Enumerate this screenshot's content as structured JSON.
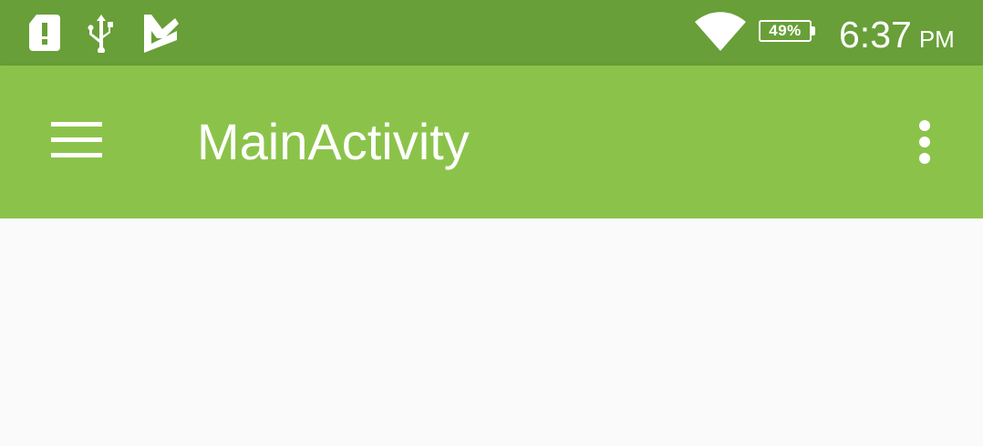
{
  "status_bar": {
    "icons": [
      "sim-alert-icon",
      "usb-icon",
      "check-icon",
      "wifi-icon",
      "battery-icon"
    ],
    "battery_level": "49%",
    "time": "6:37",
    "ampm": "PM"
  },
  "app_bar": {
    "title": "MainActivity",
    "navigation_icon": "hamburger-menu-icon",
    "overflow_icon": "more-vert-icon"
  },
  "colors": {
    "status_bar": "#689f38",
    "app_bar": "#8bc34a",
    "background": "#fafafa"
  }
}
